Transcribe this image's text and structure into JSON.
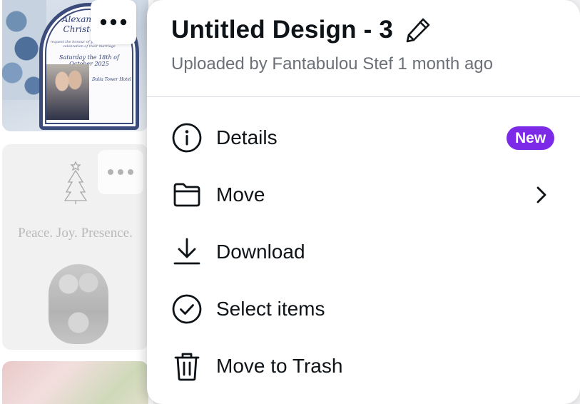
{
  "thumbnails": {
    "wedding_card": {
      "name_script": "Alexandra & Christopher",
      "fine_print": "request the honour of your company at the celebration of their marriage",
      "date_script": "Saturday the 18th of October 2025",
      "side_script": "Dalia Tower Hotel"
    },
    "christmas_card": {
      "text": "Peace. Joy. Presence."
    },
    "more_button_glyph": "•••"
  },
  "menu": {
    "title": "Untitled Design - 3",
    "subtitle": "Uploaded by Fantabulou Stef 1 month ago",
    "items": [
      {
        "label": "Details",
        "icon": "info-icon",
        "badge": "New"
      },
      {
        "label": "Move",
        "icon": "folder-icon",
        "has_submenu": true
      },
      {
        "label": "Download",
        "icon": "download-icon"
      },
      {
        "label": "Select items",
        "icon": "check-circle-icon"
      },
      {
        "label": "Move to Trash",
        "icon": "trash-icon"
      }
    ]
  },
  "colors": {
    "badge_bg": "#7d2ae8",
    "text_primary": "#0e1318",
    "text_secondary": "#6b6f76"
  }
}
